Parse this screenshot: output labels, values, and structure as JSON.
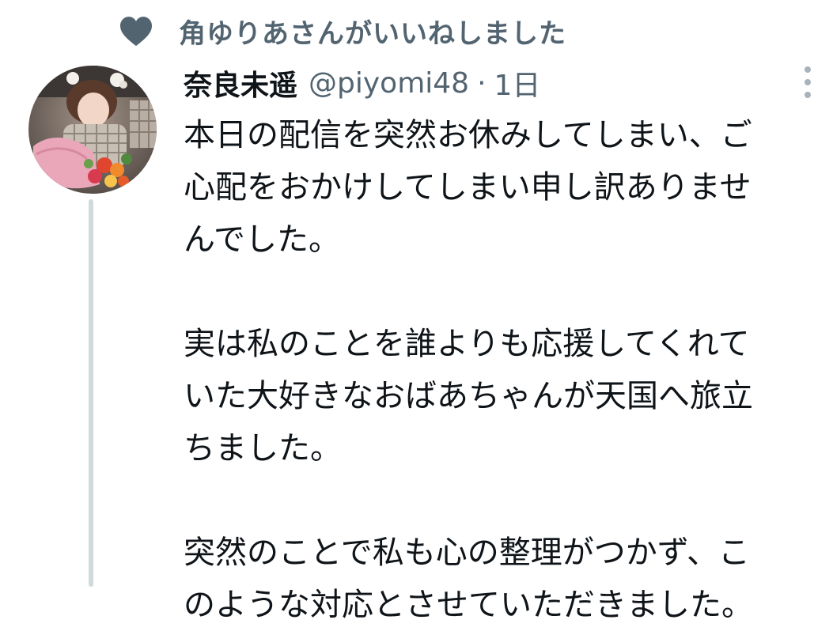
{
  "social_context": {
    "icon": "heart-icon",
    "text": "角ゆりあさんがいいねしました"
  },
  "tweet": {
    "display_name": "奈良未遥",
    "handle": "@piyomi48",
    "separator": "·",
    "time": "1日",
    "more_icon": "more-vertical-icon",
    "paragraphs": [
      "本日の配信を突然お休みしてしまい、ご\n心配をおかけしてしまい申し訳ありませ\nんでした。",
      "実は私のことを誰よりも応援してくれて\nいた大好きなおばあちゃんが天国へ旅立\nちました。",
      "突然のことで私も心の整理がつかず、こ\nのような対応とさせていただきました。"
    ]
  },
  "colors": {
    "primary_text": "#0f1419",
    "secondary_text": "#536471",
    "thread_line": "#cfd9de",
    "heart": "#536471"
  }
}
